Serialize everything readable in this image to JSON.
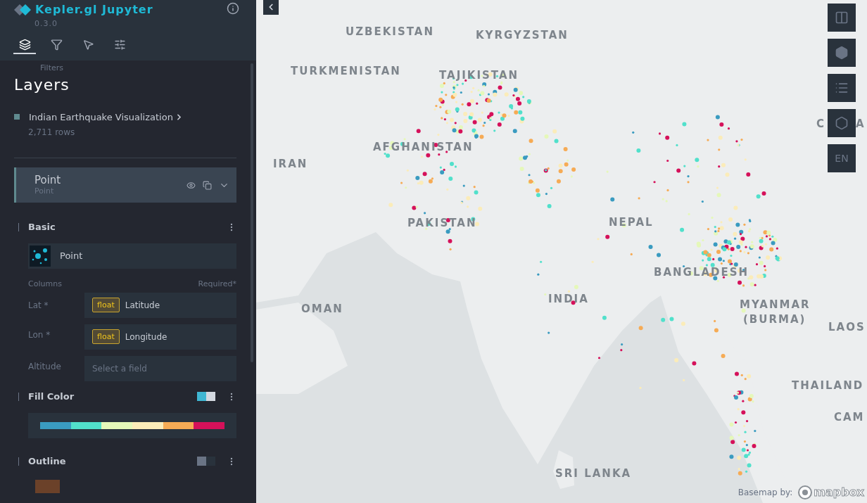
{
  "app": {
    "title": "Kepler.gl Jupyter",
    "version": "0.3.0"
  },
  "tabs": [
    {
      "kind": "layers",
      "selected": true
    },
    {
      "kind": "filters",
      "selected": false
    },
    {
      "kind": "interactions",
      "selected": false
    },
    {
      "kind": "settings",
      "selected": false
    }
  ],
  "tooltip": "Filters",
  "panel_title": "Layers",
  "dataset": {
    "name": "Indian Earthquake Visualization",
    "rows": "2,711 rows",
    "color": "#5f8a8f"
  },
  "layer": {
    "name": "Point",
    "type": "Point",
    "visible": true,
    "expanded": true
  },
  "basic": {
    "title": "Basic",
    "layer_type": "Point",
    "columns_label": "Columns",
    "required_label": "Required*",
    "fields": [
      {
        "label": "Lat *",
        "type": "float",
        "value": "Latitude"
      },
      {
        "label": "Lon *",
        "type": "float",
        "value": "Longitude"
      },
      {
        "label": "Altitude",
        "placeholder": "Select a field"
      }
    ]
  },
  "fill": {
    "title": "Fill Color",
    "on": true,
    "palette": [
      {
        "color": "#3a9bc0"
      },
      {
        "color": "#51e0cb"
      },
      {
        "color": "#e5f8b9"
      },
      {
        "color": "#fbecb9"
      },
      {
        "color": "#f6ab55"
      },
      {
        "color": "#d5115a"
      }
    ]
  },
  "outline": {
    "title": "Outline",
    "on": false,
    "color": "#6b4129"
  },
  "map": {
    "labels": [
      {
        "text": "UZBEKISTAN"
      },
      {
        "text": "KYRGYZSTAN"
      },
      {
        "text": "TURKMENISTAN"
      },
      {
        "text": "TAJIKISTAN"
      },
      {
        "text": "AFGHANISTAN"
      },
      {
        "text": "IRAN"
      },
      {
        "text": "PAKISTAN"
      },
      {
        "text": "NEPAL"
      },
      {
        "text": "BANGLADESH"
      },
      {
        "text": "INDIA"
      },
      {
        "text": "OMAN"
      },
      {
        "text": "MYANMAR"
      },
      {
        "text": "(BURMA)"
      },
      {
        "text": "LAOS"
      },
      {
        "text": "THAILAND"
      },
      {
        "text": "CAM"
      },
      {
        "text": "SRI LANKA"
      },
      {
        "text": "C"
      },
      {
        "text": "A"
      }
    ],
    "controls": [
      {
        "kind": "split"
      },
      {
        "kind": "cube"
      },
      {
        "kind": "legend"
      },
      {
        "kind": "draw"
      },
      {
        "kind": "locale",
        "label": "EN"
      }
    ],
    "attribution": "Basemap by:",
    "brand": "mapbox"
  }
}
